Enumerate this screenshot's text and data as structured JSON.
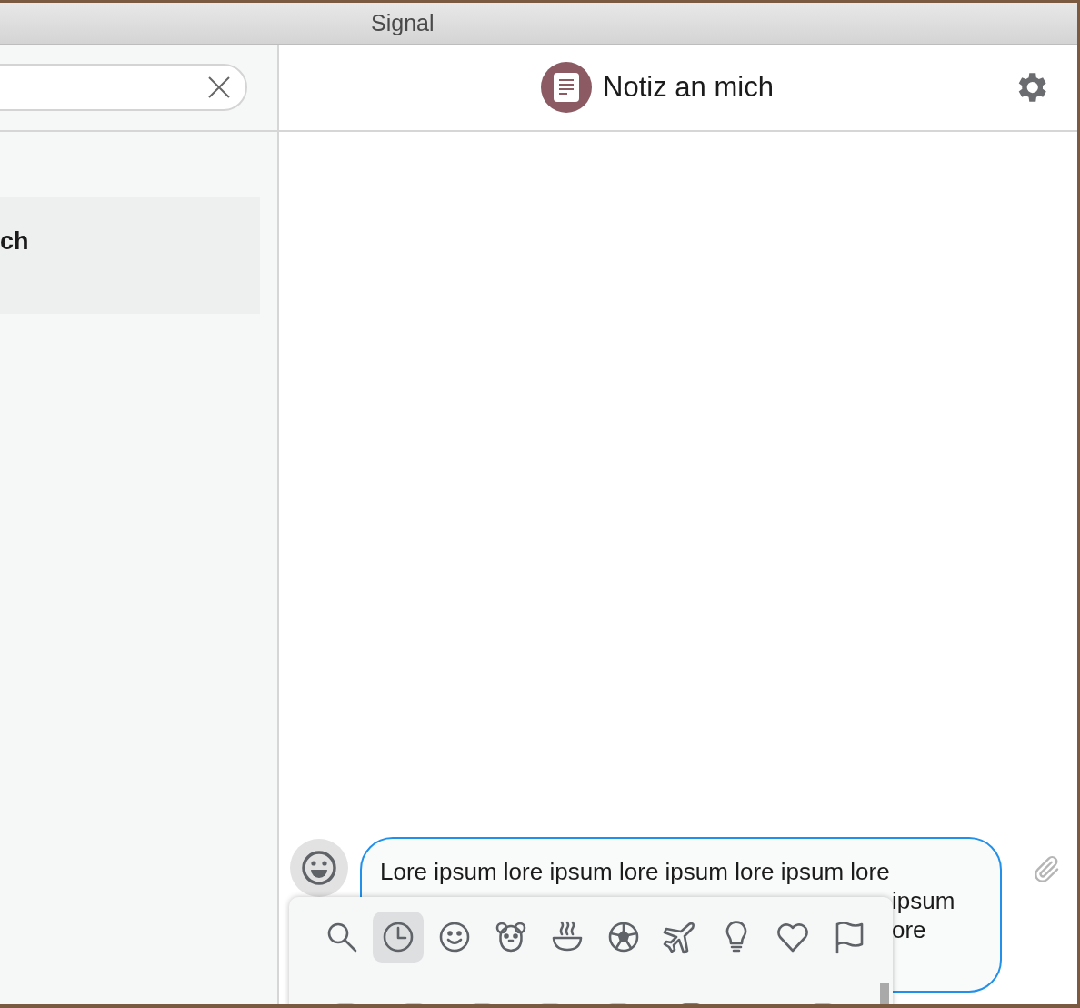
{
  "window": {
    "title": "Signal"
  },
  "sidebar": {
    "items": [
      {
        "title": "ch",
        "selected": true
      }
    ]
  },
  "conversation": {
    "title": "Notiz an mich"
  },
  "composer": {
    "lines": [
      "Lore ipsum lore ipsum lore ipsum lore ipsum lore",
      "ipsum",
      "ore"
    ]
  },
  "emoji_picker": {
    "tabs": [
      {
        "kind": "search",
        "selected": false
      },
      {
        "kind": "recent",
        "selected": true
      },
      {
        "kind": "smileys",
        "selected": false
      },
      {
        "kind": "animals",
        "selected": false
      },
      {
        "kind": "food",
        "selected": false
      },
      {
        "kind": "activity",
        "selected": false
      },
      {
        "kind": "travel",
        "selected": false
      },
      {
        "kind": "objects",
        "selected": false
      },
      {
        "kind": "symbols",
        "selected": false
      },
      {
        "kind": "flags",
        "selected": false
      }
    ]
  }
}
